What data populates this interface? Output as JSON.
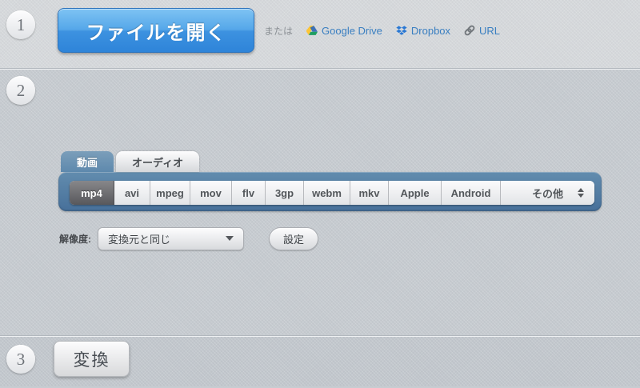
{
  "steps": {
    "one": "1",
    "two": "2",
    "three": "3"
  },
  "section1": {
    "open_button_label": "ファイルを開く",
    "or_text": "または",
    "links": [
      {
        "label": "Google Drive",
        "icon": "google-drive-icon"
      },
      {
        "label": "Dropbox",
        "icon": "dropbox-icon"
      },
      {
        "label": "URL",
        "icon": "link-icon"
      }
    ]
  },
  "section2": {
    "tabs": [
      {
        "label": "動画",
        "active": true
      },
      {
        "label": "オーディオ",
        "active": false
      }
    ],
    "formats": [
      {
        "label": "mp4",
        "selected": true
      },
      {
        "label": "avi"
      },
      {
        "label": "mpeg"
      },
      {
        "label": "mov"
      },
      {
        "label": "flv"
      },
      {
        "label": "3gp"
      },
      {
        "label": "webm"
      },
      {
        "label": "mkv"
      },
      {
        "label": "Apple"
      },
      {
        "label": "Android"
      },
      {
        "label": "その他",
        "has_spinner": true
      }
    ],
    "resolution_label": "解像度:",
    "resolution_value": "変換元と同じ",
    "settings_button_label": "設定"
  },
  "section3": {
    "convert_button_label": "変換"
  },
  "colors": {
    "accent_blue_button": "#3d92e0",
    "steel_blue_bar": "#4f7aa0",
    "link_blue": "#3a7fc1",
    "selected_segment": "#58585c",
    "background_light": "#d7dadd",
    "background_mid": "#c7ccd1"
  }
}
